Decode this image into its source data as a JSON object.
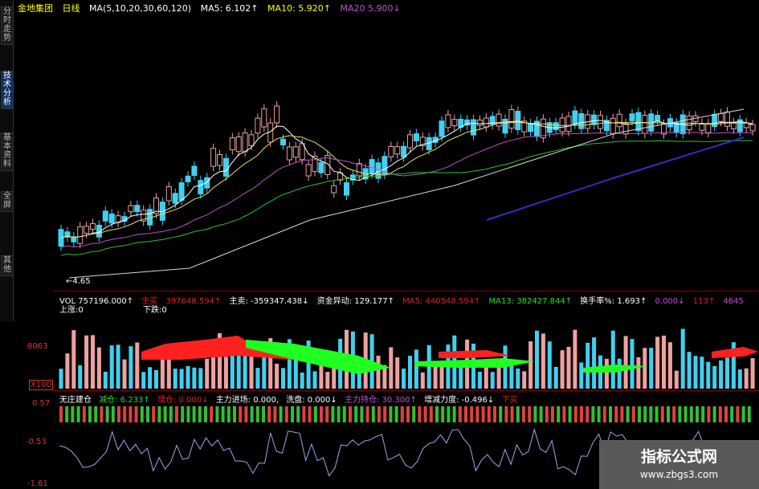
{
  "sidebar": {
    "tabs": [
      "分时走势",
      "技术分析",
      "基本资料",
      "全屏",
      "其他"
    ],
    "active": 1
  },
  "header": {
    "stock": "金地集团",
    "period": "日线",
    "ma_params": "MA(5,10,20,30,60,120)",
    "ma5": "MA5: 6.102↑",
    "ma10": "MA10: 5.920↑",
    "ma20": "MA20 5.900↓"
  },
  "price_panel": {
    "low_label": "←4.65"
  },
  "volume_panel": {
    "vol": "VOL 757196.000↑",
    "zhu_label": "主买",
    "zhu_val": "397648.594↑",
    "main_sell": "主卖: -359347.438↓",
    "capital": "资金异动: 129.177↑",
    "ma5": "MA5: 440548.594↑",
    "ma13": "MA13: 382427.844↑",
    "turnover": "换手率%: 1.693↑",
    "v1": "0.000↓",
    "v2": "113↑",
    "v3": "4645",
    "up_label": "上涨:0",
    "down_label": "下跌:0",
    "y_label": "8063",
    "unit_label": "X100"
  },
  "indicator_panel": {
    "name": "无庄建仓",
    "reduce": "减仓: 6.233↑",
    "increase": "增仓: 0.000↓",
    "main_enter": "主力进场: 0.000,",
    "wash": "洗盘: 0.000↓",
    "main_hold": "主力持仓: 30.300↑",
    "delta": "增减力度: -0.496↓",
    "tail": "下买",
    "y_top": "0.57",
    "y_mid": "-0.53",
    "y_bot": "-1.61"
  },
  "watermark": {
    "title": "指标公式网",
    "url": "www.zbgs3.com"
  },
  "colors": {
    "up": "#e8a0a0",
    "down": "#40d0f0",
    "red": "#ff2020",
    "green": "#20ff20",
    "purple": "#c050d0",
    "blue": "#3030c0"
  }
}
